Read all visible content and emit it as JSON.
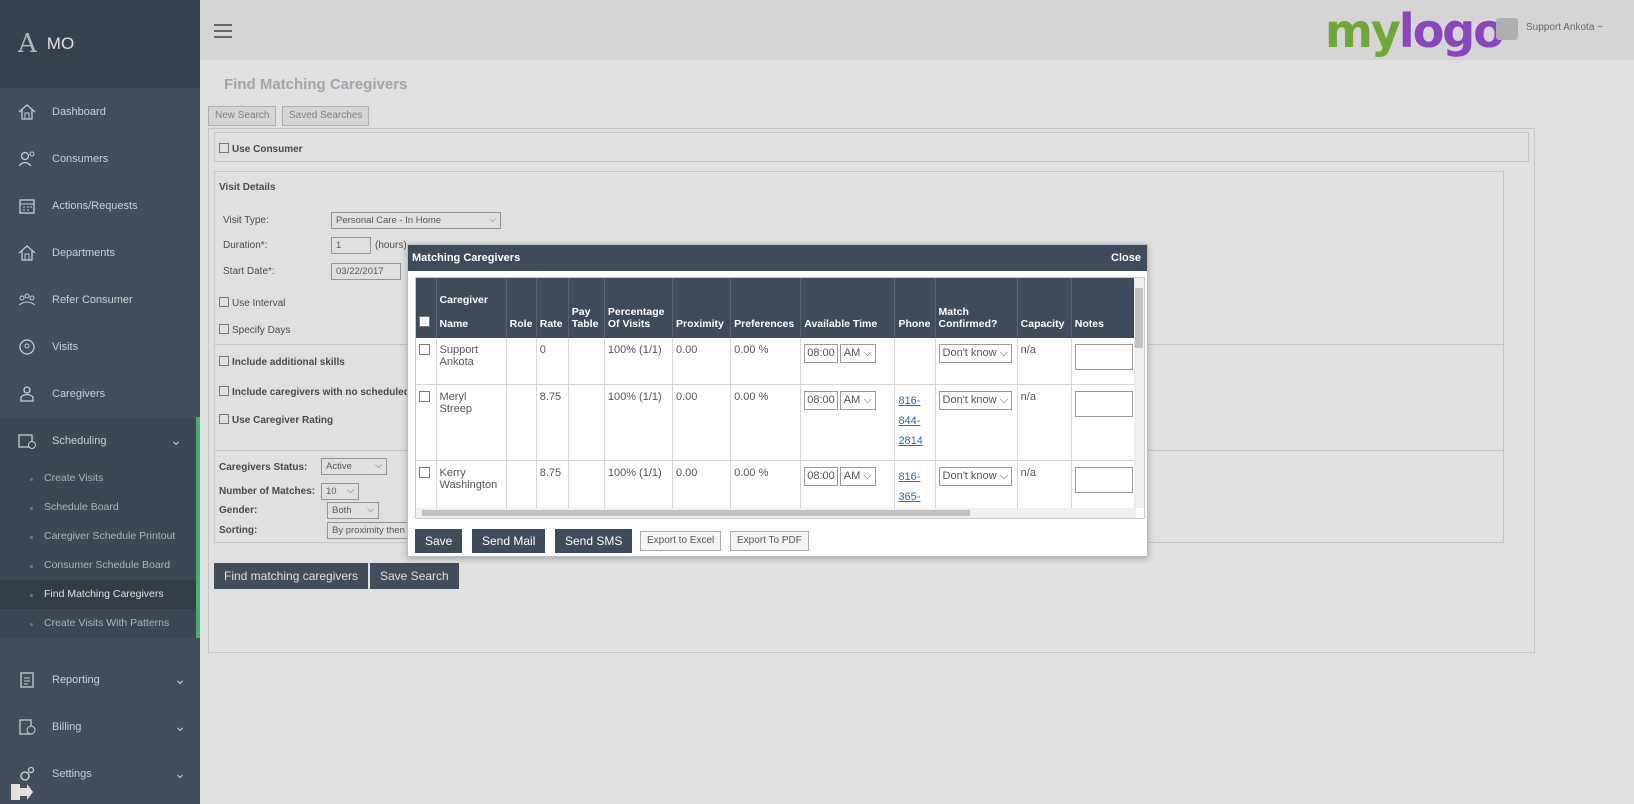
{
  "sidebar": {
    "brand": "MO",
    "items": [
      {
        "label": "Dashboard"
      },
      {
        "label": "Consumers"
      },
      {
        "label": "Actions/Requests"
      },
      {
        "label": "Departments"
      },
      {
        "label": "Refer Consumer"
      },
      {
        "label": "Visits"
      },
      {
        "label": "Caregivers"
      },
      {
        "label": "Scheduling"
      }
    ],
    "scheduling_sub": [
      "Create Visits",
      "Schedule Board",
      "Caregiver Schedule Printout",
      "Consumer Schedule Board",
      "Find Matching Caregivers",
      "Create Visits With Patterns"
    ],
    "bottom_items": [
      {
        "label": "Reporting"
      },
      {
        "label": "Billing"
      },
      {
        "label": "Settings"
      }
    ]
  },
  "topbar": {
    "logo_my": "my",
    "logo_logo": "logo",
    "user_name": "Support Ankota ~"
  },
  "page": {
    "title": "Find Matching Caregivers",
    "tabs": [
      "New Search",
      "Saved Searches"
    ],
    "use_consumer": "Use Consumer",
    "visit_details": "Visit Details",
    "visit_type_label": "Visit Type:",
    "visit_type_value": "Personal Care - In Home",
    "duration_label": "Duration*:",
    "duration_value": "1",
    "duration_unit": "(hours)",
    "start_date_label": "Start Date*:",
    "start_date_value": "03/22/2017",
    "use_interval": "Use Interval",
    "specify_days": "Specify Days",
    "include_skills": "Include additional skills",
    "include_no_schedule": "Include caregivers with no scheduled",
    "use_rating": "Use Caregiver Rating",
    "status_label": "Caregivers Status:",
    "status_value": "Active",
    "matches_label": "Number of Matches:",
    "matches_value": "10",
    "gender_label": "Gender:",
    "gender_value": "Both",
    "sorting_label": "Sorting:",
    "sorting_value": "By proximity then",
    "find_button": "Find matching caregivers",
    "save_search_button": "Save Search"
  },
  "modal": {
    "title": "Matching Caregivers",
    "close": "Close",
    "columns": {
      "name_top": "Caregiver",
      "name_bottom": "Name",
      "role": "Role",
      "rate": "Rate",
      "pay_top": "Pay",
      "pay_bottom": "Table",
      "pct_top": "Percentage",
      "pct_bottom": "Of Visits",
      "proximity": "Proximity",
      "preferences": "Preferences",
      "available": "Available Time",
      "phone": "Phone",
      "match_top": "Match",
      "match_bottom": "Confirmed?",
      "capacity": "Capacity",
      "notes": "Notes"
    },
    "rows": [
      {
        "name_1": "Support",
        "name_2": "Ankota",
        "rate": "0",
        "pct": "100% (1/1)",
        "proximity": "0.00",
        "pref": "0.00 %",
        "time": "08:00",
        "ampm": "AM",
        "phone_1": "",
        "phone_2": "",
        "phone_3": "",
        "match": "Don't know",
        "capacity": "n/a"
      },
      {
        "name_1": "Meryl",
        "name_2": "Streep",
        "rate": "8.75",
        "pct": "100% (1/1)",
        "proximity": "0.00",
        "pref": "0.00 %",
        "time": "08:00",
        "ampm": "AM",
        "phone_1": "816-",
        "phone_2": "844-",
        "phone_3": "2814",
        "match": "Don't know",
        "capacity": "n/a"
      },
      {
        "name_1": "Kerry",
        "name_2": "Washington",
        "rate": "8.75",
        "pct": "100% (1/1)",
        "proximity": "0.00",
        "pref": "0.00 %",
        "time": "08:00",
        "ampm": "AM",
        "phone_1": "816-",
        "phone_2": "365-",
        "phone_3": "",
        "match": "Don't know",
        "capacity": "n/a"
      }
    ],
    "buttons": {
      "save": "Save",
      "send_mail": "Send Mail",
      "send_sms": "Send SMS",
      "export_excel": "Export to Excel",
      "export_pdf": "Export To PDF"
    }
  }
}
